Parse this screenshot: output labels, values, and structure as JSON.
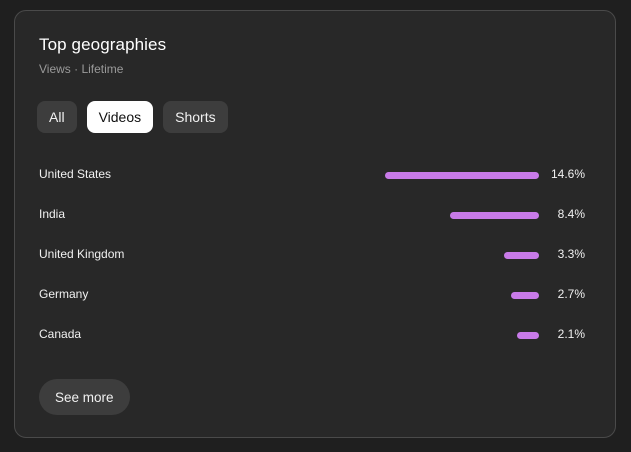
{
  "card": {
    "title": "Top geographies",
    "subtitle": "Views · Lifetime"
  },
  "filters": {
    "options": [
      "All",
      "Videos",
      "Shorts"
    ],
    "selected": "Videos"
  },
  "geographies": [
    {
      "country": "United States",
      "percent": 14.6,
      "label": "14.6%"
    },
    {
      "country": "India",
      "percent": 8.4,
      "label": "8.4%"
    },
    {
      "country": "United Kingdom",
      "percent": 3.3,
      "label": "3.3%"
    },
    {
      "country": "Germany",
      "percent": 2.7,
      "label": "2.7%"
    },
    {
      "country": "Canada",
      "percent": 2.1,
      "label": "2.1%"
    }
  ],
  "see_more_label": "See more",
  "colors": {
    "bar": "#c87ae8",
    "card_bg": "#282828",
    "page_bg": "#1f1f1f"
  }
}
